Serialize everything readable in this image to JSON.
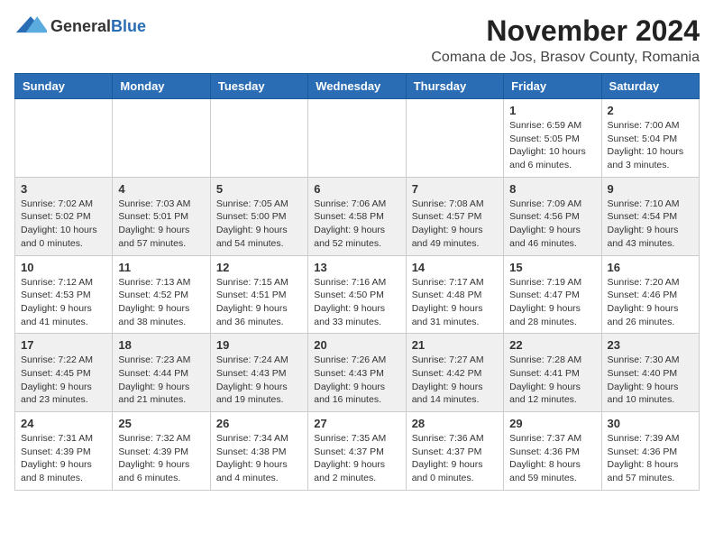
{
  "header": {
    "logo_general": "General",
    "logo_blue": "Blue",
    "month_title": "November 2024",
    "location": "Comana de Jos, Brasov County, Romania"
  },
  "days_of_week": [
    "Sunday",
    "Monday",
    "Tuesday",
    "Wednesday",
    "Thursday",
    "Friday",
    "Saturday"
  ],
  "weeks": [
    [
      {
        "day": "",
        "info": ""
      },
      {
        "day": "",
        "info": ""
      },
      {
        "day": "",
        "info": ""
      },
      {
        "day": "",
        "info": ""
      },
      {
        "day": "",
        "info": ""
      },
      {
        "day": "1",
        "info": "Sunrise: 6:59 AM\nSunset: 5:05 PM\nDaylight: 10 hours and 6 minutes."
      },
      {
        "day": "2",
        "info": "Sunrise: 7:00 AM\nSunset: 5:04 PM\nDaylight: 10 hours and 3 minutes."
      }
    ],
    [
      {
        "day": "3",
        "info": "Sunrise: 7:02 AM\nSunset: 5:02 PM\nDaylight: 10 hours and 0 minutes."
      },
      {
        "day": "4",
        "info": "Sunrise: 7:03 AM\nSunset: 5:01 PM\nDaylight: 9 hours and 57 minutes."
      },
      {
        "day": "5",
        "info": "Sunrise: 7:05 AM\nSunset: 5:00 PM\nDaylight: 9 hours and 54 minutes."
      },
      {
        "day": "6",
        "info": "Sunrise: 7:06 AM\nSunset: 4:58 PM\nDaylight: 9 hours and 52 minutes."
      },
      {
        "day": "7",
        "info": "Sunrise: 7:08 AM\nSunset: 4:57 PM\nDaylight: 9 hours and 49 minutes."
      },
      {
        "day": "8",
        "info": "Sunrise: 7:09 AM\nSunset: 4:56 PM\nDaylight: 9 hours and 46 minutes."
      },
      {
        "day": "9",
        "info": "Sunrise: 7:10 AM\nSunset: 4:54 PM\nDaylight: 9 hours and 43 minutes."
      }
    ],
    [
      {
        "day": "10",
        "info": "Sunrise: 7:12 AM\nSunset: 4:53 PM\nDaylight: 9 hours and 41 minutes."
      },
      {
        "day": "11",
        "info": "Sunrise: 7:13 AM\nSunset: 4:52 PM\nDaylight: 9 hours and 38 minutes."
      },
      {
        "day": "12",
        "info": "Sunrise: 7:15 AM\nSunset: 4:51 PM\nDaylight: 9 hours and 36 minutes."
      },
      {
        "day": "13",
        "info": "Sunrise: 7:16 AM\nSunset: 4:50 PM\nDaylight: 9 hours and 33 minutes."
      },
      {
        "day": "14",
        "info": "Sunrise: 7:17 AM\nSunset: 4:48 PM\nDaylight: 9 hours and 31 minutes."
      },
      {
        "day": "15",
        "info": "Sunrise: 7:19 AM\nSunset: 4:47 PM\nDaylight: 9 hours and 28 minutes."
      },
      {
        "day": "16",
        "info": "Sunrise: 7:20 AM\nSunset: 4:46 PM\nDaylight: 9 hours and 26 minutes."
      }
    ],
    [
      {
        "day": "17",
        "info": "Sunrise: 7:22 AM\nSunset: 4:45 PM\nDaylight: 9 hours and 23 minutes."
      },
      {
        "day": "18",
        "info": "Sunrise: 7:23 AM\nSunset: 4:44 PM\nDaylight: 9 hours and 21 minutes."
      },
      {
        "day": "19",
        "info": "Sunrise: 7:24 AM\nSunset: 4:43 PM\nDaylight: 9 hours and 19 minutes."
      },
      {
        "day": "20",
        "info": "Sunrise: 7:26 AM\nSunset: 4:43 PM\nDaylight: 9 hours and 16 minutes."
      },
      {
        "day": "21",
        "info": "Sunrise: 7:27 AM\nSunset: 4:42 PM\nDaylight: 9 hours and 14 minutes."
      },
      {
        "day": "22",
        "info": "Sunrise: 7:28 AM\nSunset: 4:41 PM\nDaylight: 9 hours and 12 minutes."
      },
      {
        "day": "23",
        "info": "Sunrise: 7:30 AM\nSunset: 4:40 PM\nDaylight: 9 hours and 10 minutes."
      }
    ],
    [
      {
        "day": "24",
        "info": "Sunrise: 7:31 AM\nSunset: 4:39 PM\nDaylight: 9 hours and 8 minutes."
      },
      {
        "day": "25",
        "info": "Sunrise: 7:32 AM\nSunset: 4:39 PM\nDaylight: 9 hours and 6 minutes."
      },
      {
        "day": "26",
        "info": "Sunrise: 7:34 AM\nSunset: 4:38 PM\nDaylight: 9 hours and 4 minutes."
      },
      {
        "day": "27",
        "info": "Sunrise: 7:35 AM\nSunset: 4:37 PM\nDaylight: 9 hours and 2 minutes."
      },
      {
        "day": "28",
        "info": "Sunrise: 7:36 AM\nSunset: 4:37 PM\nDaylight: 9 hours and 0 minutes."
      },
      {
        "day": "29",
        "info": "Sunrise: 7:37 AM\nSunset: 4:36 PM\nDaylight: 8 hours and 59 minutes."
      },
      {
        "day": "30",
        "info": "Sunrise: 7:39 AM\nSunset: 4:36 PM\nDaylight: 8 hours and 57 minutes."
      }
    ]
  ]
}
